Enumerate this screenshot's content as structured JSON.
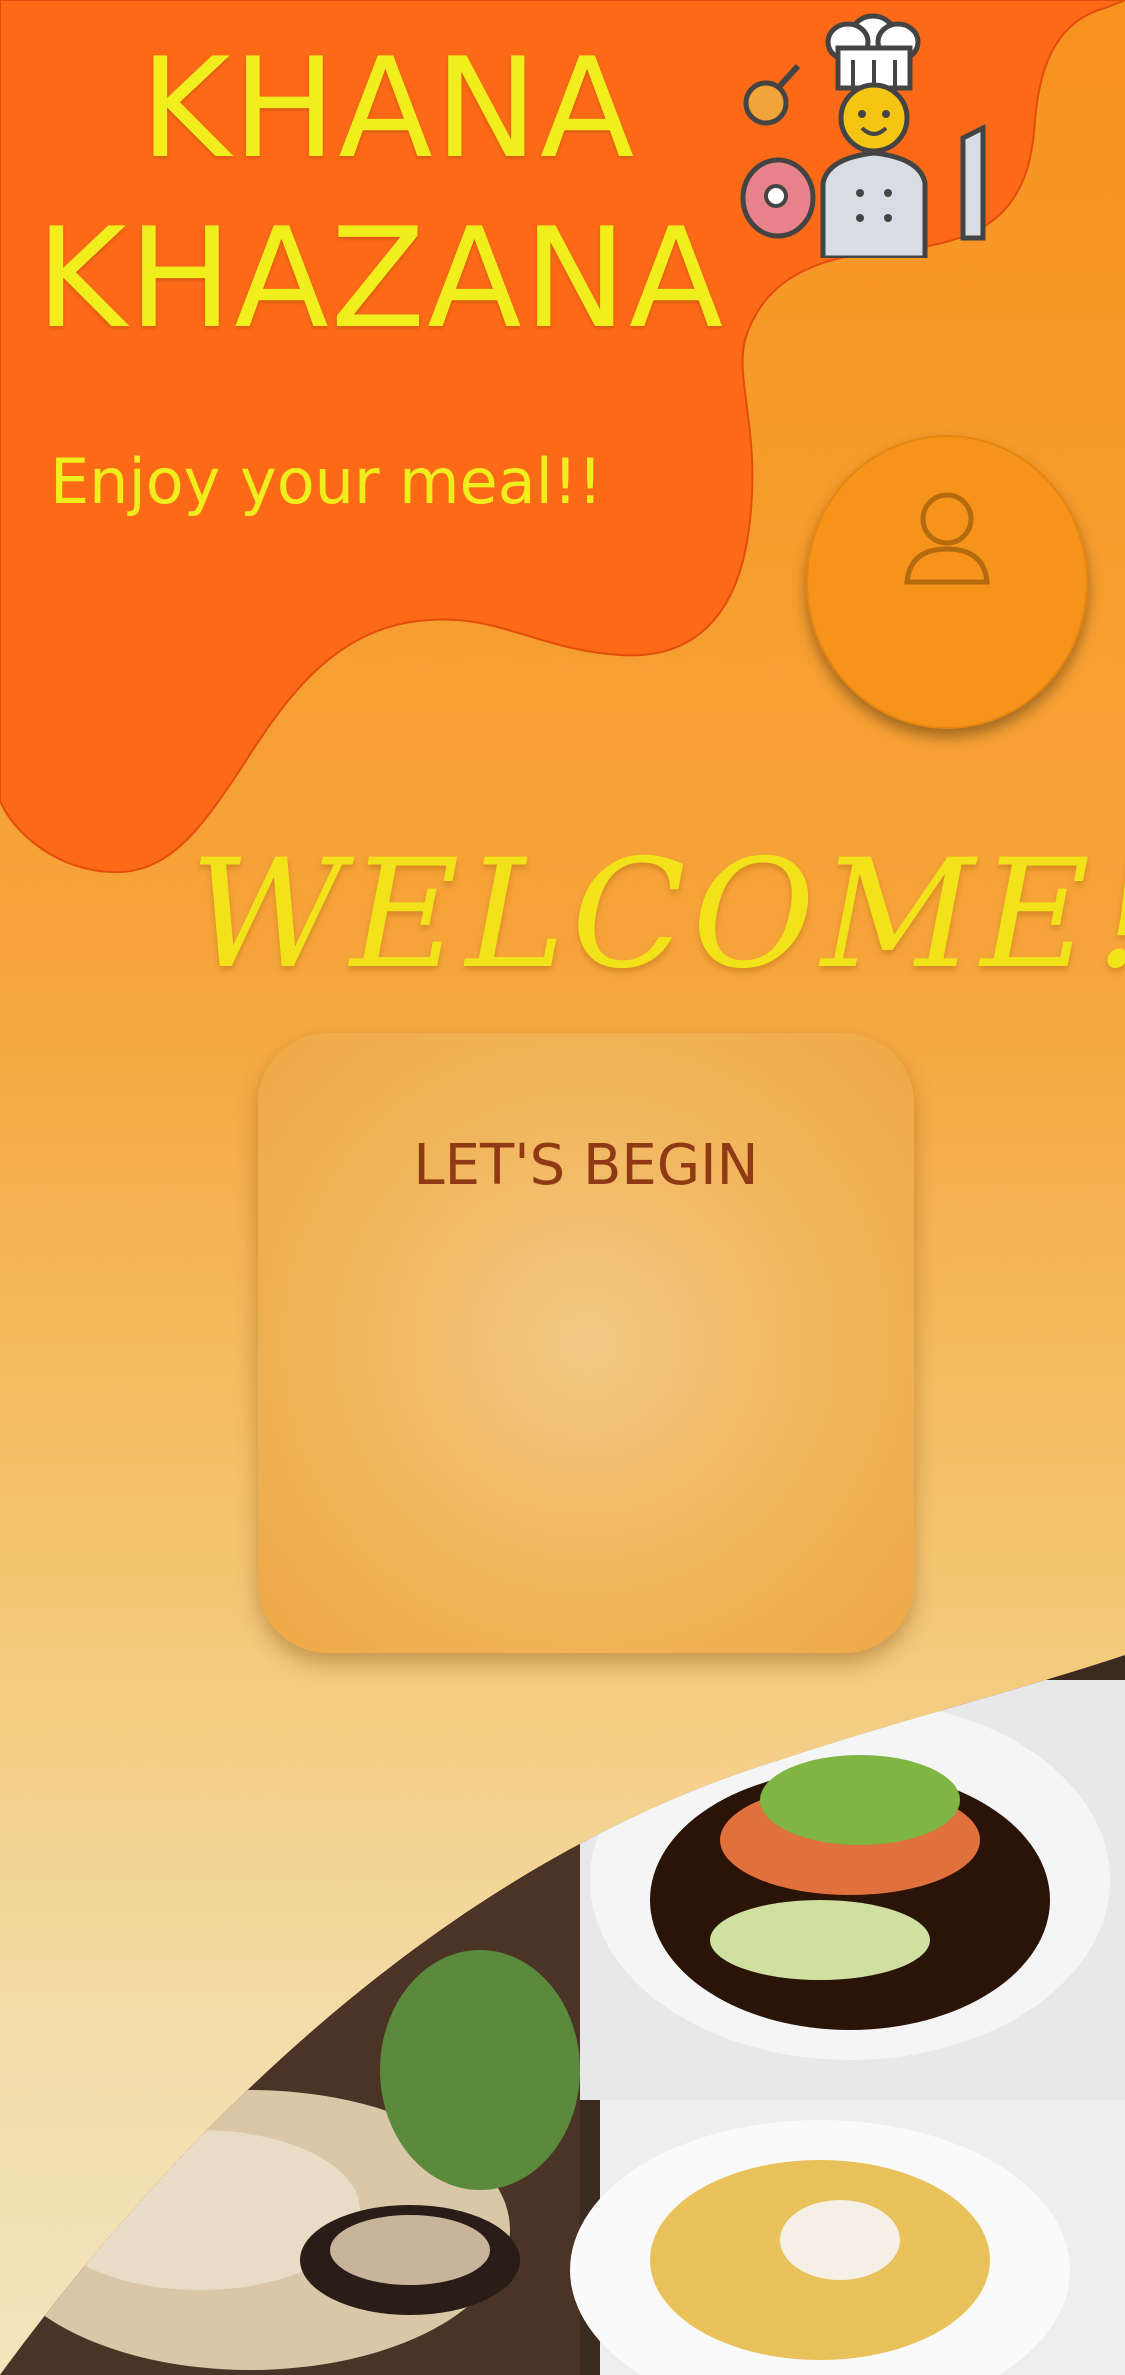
{
  "header": {
    "brand_line1": "KHANA",
    "brand_line2": "KHAZANA",
    "tagline": "Enjoy your meal!!",
    "chef_icon": "chef-icon"
  },
  "profile": {
    "icon": "user-icon"
  },
  "welcome": {
    "text": "WELCOME!"
  },
  "start_card": {
    "label": "LET'S BEGIN"
  },
  "colors": {
    "blob": "#fc6a17",
    "brand_text": "#f1ee1d",
    "button": "#f6931b",
    "card_label": "#8f3a14"
  }
}
